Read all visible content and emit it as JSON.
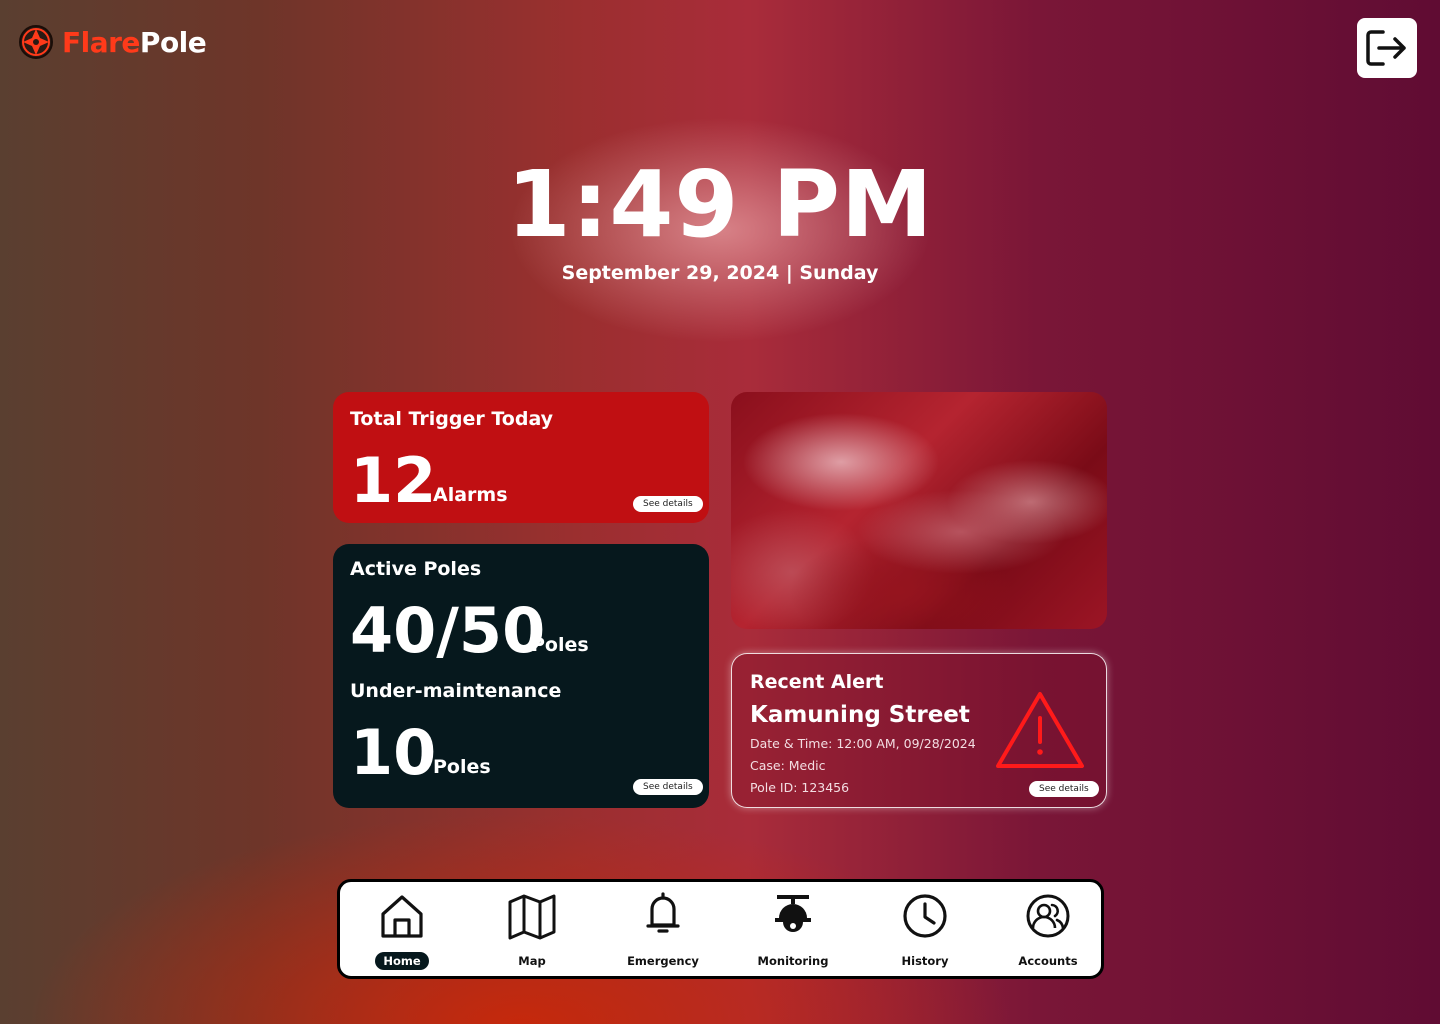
{
  "brand": {
    "name_part1": "Flare",
    "name_part2": "Pole",
    "accent": "#ff3a1a"
  },
  "header": {
    "logout_icon": "logout-icon"
  },
  "clock": {
    "time": "1:49 PM",
    "date": "September 29, 2024 | Sunday"
  },
  "trigger_card": {
    "title": "Total Trigger Today",
    "count": "12",
    "unit": "Alarms",
    "details_label": "See details",
    "color": "#c00f12"
  },
  "poles_card": {
    "active_title": "Active Poles",
    "active_count": "40/50",
    "active_unit": "Poles",
    "maint_title": "Under-maintenance",
    "maint_count": "10",
    "maint_unit": "Poles",
    "details_label": "See details",
    "color": "#06181d"
  },
  "alert_card": {
    "label": "Recent Alert",
    "street": "Kamuning Street",
    "datetime": "Date & Time: 12:00 AM, 09/28/2024",
    "case": "Case: Medic",
    "pole_id": "Pole ID: 123456",
    "details_label": "See details",
    "icon": "warning-icon"
  },
  "nav": {
    "items": [
      {
        "label": "Home",
        "icon": "home-icon",
        "active": true
      },
      {
        "label": "Map",
        "icon": "map-icon"
      },
      {
        "label": "Emergency",
        "icon": "bell-icon"
      },
      {
        "label": "Monitoring",
        "icon": "cctv-icon"
      },
      {
        "label": "History",
        "icon": "clock-icon"
      },
      {
        "label": "Accounts",
        "icon": "accounts-icon"
      }
    ]
  }
}
